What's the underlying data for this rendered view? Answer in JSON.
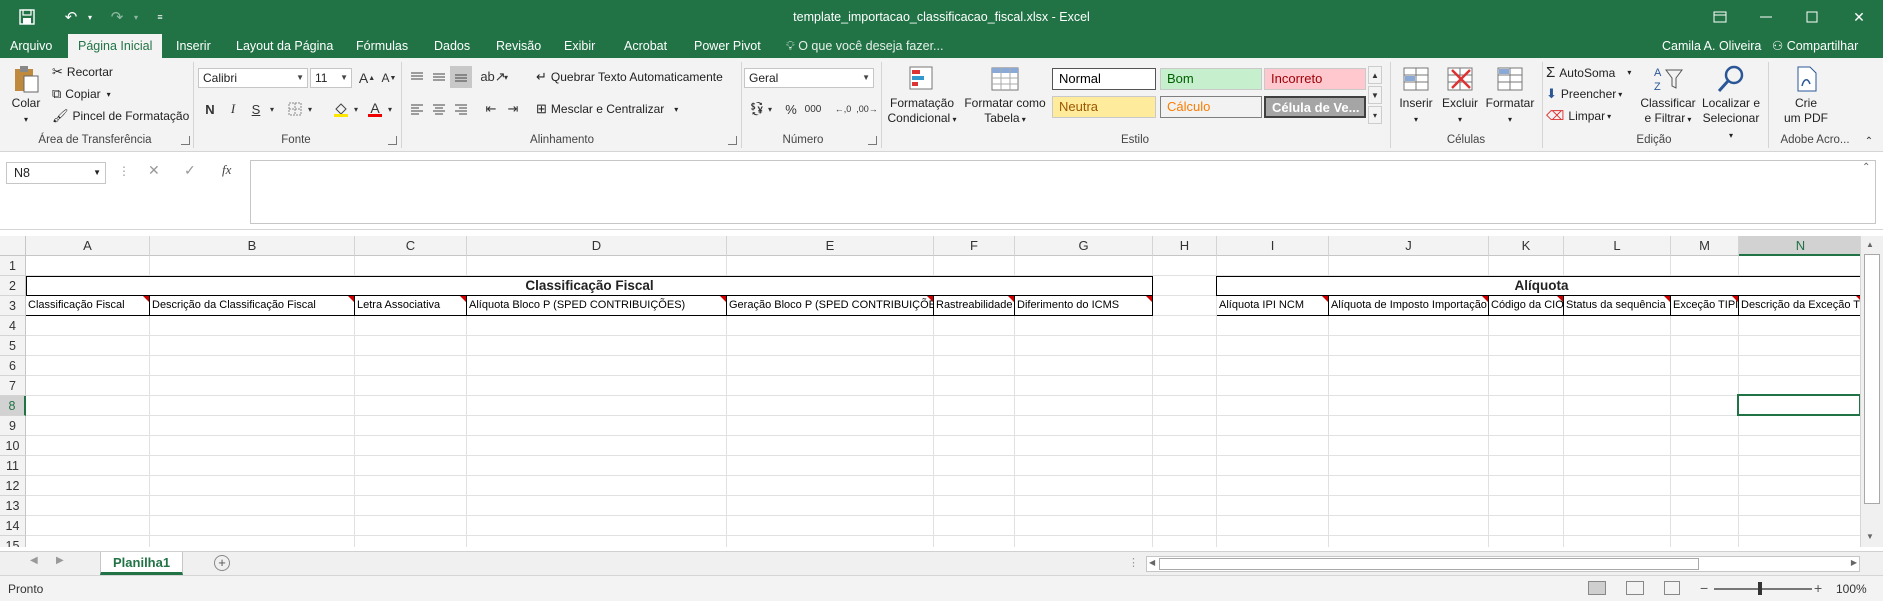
{
  "titlebar": {
    "title": "template_importacao_classificacao_fiscal.xlsx - Excel",
    "save_icon": "save-icon",
    "undo_icon": "undo-icon",
    "redo_icon": "redo-icon",
    "customize_icon": "customize-qa-icon"
  },
  "tabs": {
    "file": "Arquivo",
    "items": [
      "Página Inicial",
      "Inserir",
      "Layout da Página",
      "Fórmulas",
      "Dados",
      "Revisão",
      "Exibir",
      "Acrobat",
      "Power Pivot"
    ],
    "tell_me": "O que você deseja fazer...",
    "user": "Camila A. Oliveira",
    "share": "Compartilhar"
  },
  "ribbon": {
    "clipboard": {
      "paste": "Colar",
      "cut": "Recortar",
      "copy": "Copiar",
      "format_painter": "Pincel de Formatação",
      "label": "Área de Transferência"
    },
    "font": {
      "name": "Calibri",
      "size": "11",
      "bold": "N",
      "italic": "I",
      "underline": "S",
      "label": "Fonte"
    },
    "alignment": {
      "wrap": "Quebrar Texto Automaticamente",
      "merge": "Mesclar e Centralizar",
      "label": "Alinhamento"
    },
    "number": {
      "format": "Geral",
      "percent": "%",
      "thousands": "000",
      "label": "Número"
    },
    "styles": {
      "conditional": [
        "Formatação",
        "Condicional"
      ],
      "format_table": [
        "Formatar como",
        "Tabela"
      ],
      "normal": "Normal",
      "good": "Bom",
      "bad": "Incorreto",
      "neutral": "Neutra",
      "calc": "Cálculo",
      "check": "Célula de Ve...",
      "label": "Estilo"
    },
    "cells": {
      "insert": "Inserir",
      "delete": "Excluir",
      "format": "Formatar",
      "label": "Células"
    },
    "editing": {
      "autosum": "AutoSoma",
      "fill": "Preencher",
      "clear": "Limpar",
      "sort": [
        "Classificar",
        "e Filtrar"
      ],
      "find": [
        "Localizar e",
        "Selecionar"
      ],
      "label": "Edição"
    },
    "acrobat": {
      "create": [
        "Crie",
        "um PDF"
      ],
      "label": "Adobe Acro..."
    }
  },
  "formula_bar": {
    "name_box": "N8",
    "fx": "fx",
    "value": ""
  },
  "sheet": {
    "columns": [
      "A",
      "B",
      "C",
      "D",
      "E",
      "F",
      "G",
      "H",
      "I",
      "J",
      "K",
      "L",
      "M",
      "N"
    ],
    "rows": [
      "1",
      "2",
      "3",
      "4",
      "5",
      "6",
      "7",
      "8",
      "9",
      "10",
      "11",
      "12",
      "13",
      "14",
      "15"
    ],
    "group_left": "Classificação Fiscal",
    "group_right": "Alíquota",
    "headers_left": [
      "Classificação Fiscal",
      "Descrição da Classificação Fiscal",
      "Letra Associativa",
      "Alíquota Bloco P (SPED CONTRIBUIÇÕES)",
      "Geração Bloco P (SPED CONTRIBUIÇÕES)",
      "Rastreabilidade",
      "Diferimento do ICMS"
    ],
    "headers_right": [
      "Alíquota IPI NCM",
      "Alíquota de Imposto Importação",
      "Código da CIO",
      "Status da sequência",
      "Exceção TIPI",
      "Descrição da Exceção T"
    ],
    "selected_column": "N",
    "selected_row": "8"
  },
  "sheet_tabs": {
    "active": "Planilha1",
    "add": "+"
  },
  "status": {
    "ready": "Pronto",
    "zoom": "100%"
  }
}
